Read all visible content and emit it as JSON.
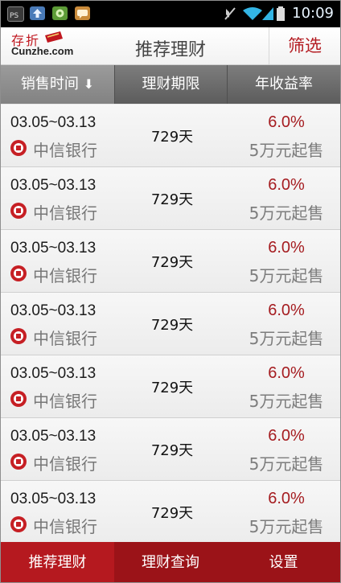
{
  "status_bar": {
    "time": "10:09",
    "left_icons": [
      "debug-icon",
      "upload-icon",
      "game-icon",
      "message-icon"
    ],
    "right_icons": [
      "mute-icon",
      "wifi-icon",
      "signal-icon",
      "battery-icon"
    ]
  },
  "header": {
    "logo_cn": "存折",
    "logo_en": "Cunzhe.com",
    "title": "推荐理财",
    "filter_label": "筛选"
  },
  "columns": {
    "sale_time": "销售时间",
    "sort_arrow": "⬇",
    "period": "理财期限",
    "annual_yield": "年收益率"
  },
  "products": [
    {
      "date": "03.05~03.13",
      "bank": "中信银行",
      "period": "729天",
      "rate": "6.0%",
      "min_buy": "5万元起售"
    },
    {
      "date": "03.05~03.13",
      "bank": "中信银行",
      "period": "729天",
      "rate": "6.0%",
      "min_buy": "5万元起售"
    },
    {
      "date": "03.05~03.13",
      "bank": "中信银行",
      "period": "729天",
      "rate": "6.0%",
      "min_buy": "5万元起售"
    },
    {
      "date": "03.05~03.13",
      "bank": "中信银行",
      "period": "729天",
      "rate": "6.0%",
      "min_buy": "5万元起售"
    },
    {
      "date": "03.05~03.13",
      "bank": "中信银行",
      "period": "729天",
      "rate": "6.0%",
      "min_buy": "5万元起售"
    },
    {
      "date": "03.05~03.13",
      "bank": "中信银行",
      "period": "729天",
      "rate": "6.0%",
      "min_buy": "5万元起售"
    },
    {
      "date": "03.05~03.13",
      "bank": "中信银行",
      "period": "729天",
      "rate": "6.0%",
      "min_buy": "5万元起售"
    }
  ],
  "bottom_nav": {
    "recommend": "推荐理财",
    "query": "理财查询",
    "settings": "设置"
  },
  "colors": {
    "brand_red": "#b41c22",
    "rate_red": "#a51c20",
    "nav_red": "#9b1318",
    "nav_active": "#b5191f"
  }
}
